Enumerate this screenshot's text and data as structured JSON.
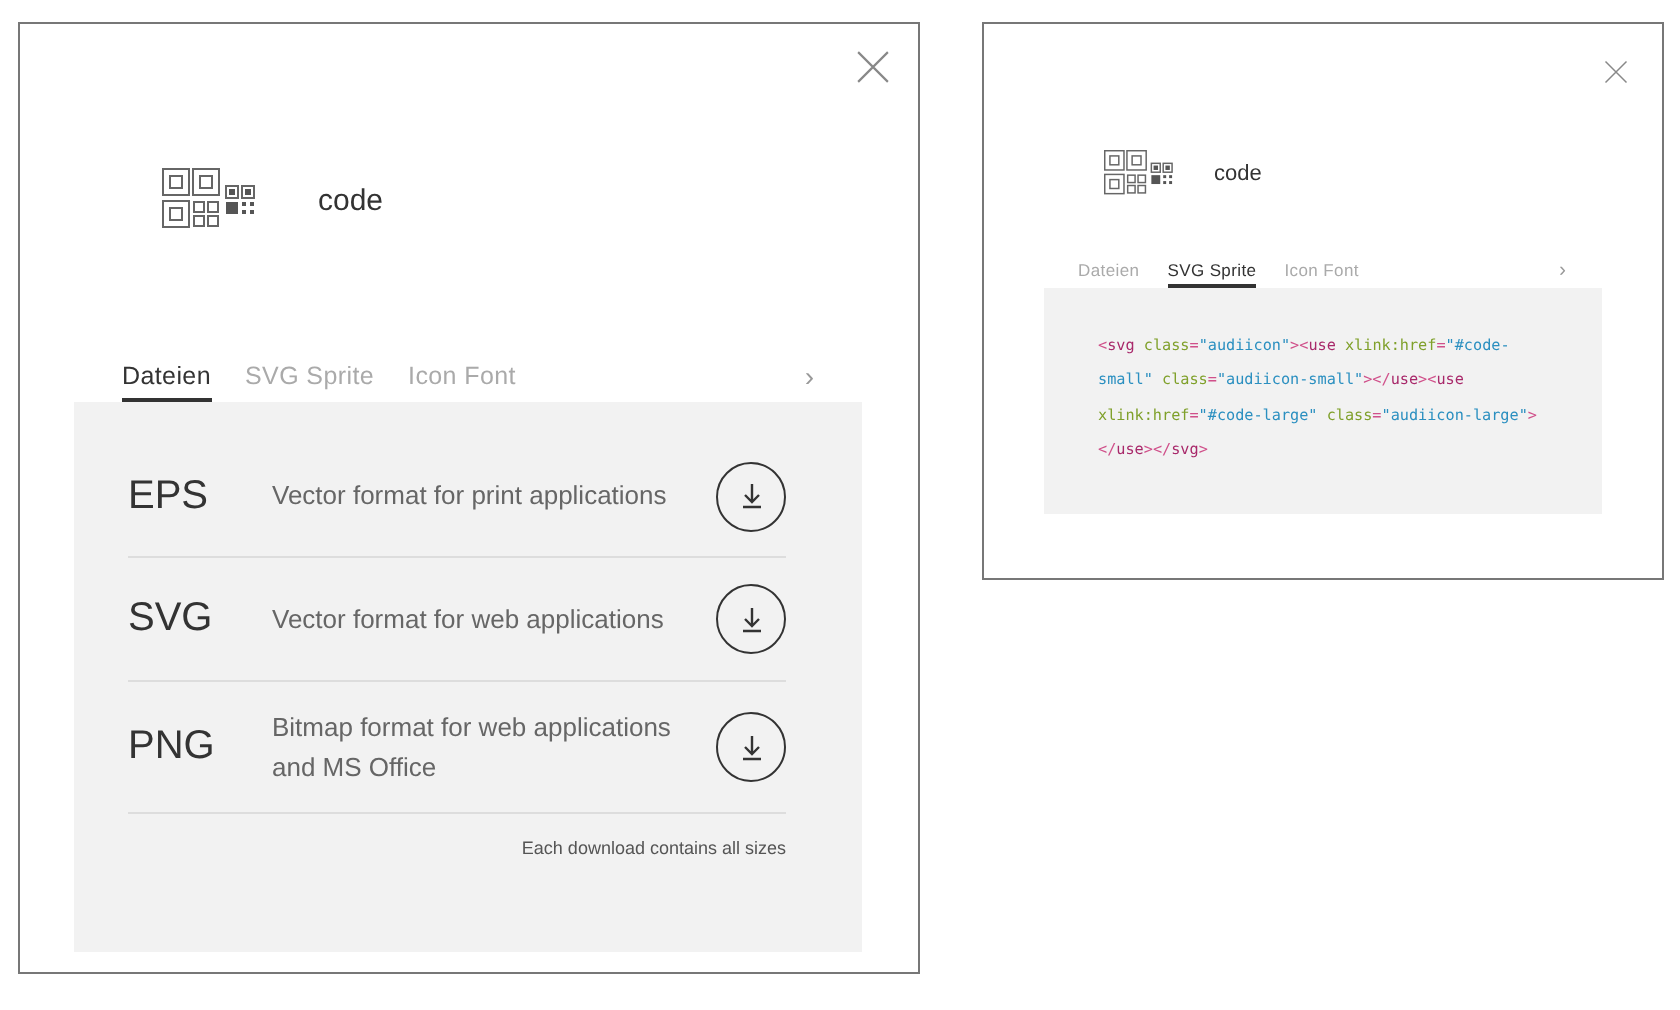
{
  "panels": [
    {
      "title": "code",
      "tabs": [
        {
          "label": "Dateien",
          "selected": true
        },
        {
          "label": "SVG Sprite",
          "selected": false
        },
        {
          "label": "Icon Font",
          "selected": false
        }
      ],
      "next": "›",
      "content": {
        "kind": "files",
        "items": [
          {
            "format": "EPS",
            "description": "Vector format for print applications"
          },
          {
            "format": "SVG",
            "description": "Vector format for web applications"
          },
          {
            "format": "PNG",
            "description": "Bitmap format for web applications and MS Office"
          }
        ],
        "note": "Each download contains all sizes"
      }
    },
    {
      "title": "code",
      "tabs": [
        {
          "label": "Dateien",
          "selected": false
        },
        {
          "label": "SVG Sprite",
          "selected": true
        },
        {
          "label": "Icon Font",
          "selected": false
        }
      ],
      "next": "›",
      "content": {
        "kind": "code",
        "lines": [
          [
            {
              "text": "<",
              "kind": "punct"
            },
            {
              "text": "svg ",
              "kind": "tag"
            },
            {
              "text": "class",
              "kind": "attr"
            },
            {
              "text": "=",
              "kind": "punct"
            },
            {
              "text": "\"audiicon\"",
              "kind": "string"
            },
            {
              "text": "><",
              "kind": "punct"
            },
            {
              "text": "use ",
              "kind": "tag"
            },
            {
              "text": "xlink:href",
              "kind": "attr"
            },
            {
              "text": "=",
              "kind": "punct"
            },
            {
              "text": "\"#code-",
              "kind": "string"
            }
          ],
          [
            {
              "text": "small\" ",
              "kind": "string"
            },
            {
              "text": "class",
              "kind": "attr"
            },
            {
              "text": "=",
              "kind": "punct"
            },
            {
              "text": "\"audiicon-small\"",
              "kind": "string"
            },
            {
              "text": "></",
              "kind": "punct"
            },
            {
              "text": "use",
              "kind": "tag"
            },
            {
              "text": "><",
              "kind": "punct"
            },
            {
              "text": "use",
              "kind": "tag"
            }
          ],
          [
            {
              "text": "xlink:href",
              "kind": "attr"
            },
            {
              "text": "=",
              "kind": "punct"
            },
            {
              "text": "\"#code-large\" ",
              "kind": "string"
            },
            {
              "text": "class",
              "kind": "attr"
            },
            {
              "text": "=",
              "kind": "punct"
            },
            {
              "text": "\"audiicon-large\"",
              "kind": "string"
            },
            {
              "text": ">",
              "kind": "punct"
            }
          ],
          [
            {
              "text": "</",
              "kind": "punct"
            },
            {
              "text": "use",
              "kind": "tag"
            },
            {
              "text": "></",
              "kind": "punct"
            },
            {
              "text": "svg",
              "kind": "tag"
            },
            {
              "text": ">",
              "kind": "punct"
            }
          ]
        ]
      }
    }
  ]
}
